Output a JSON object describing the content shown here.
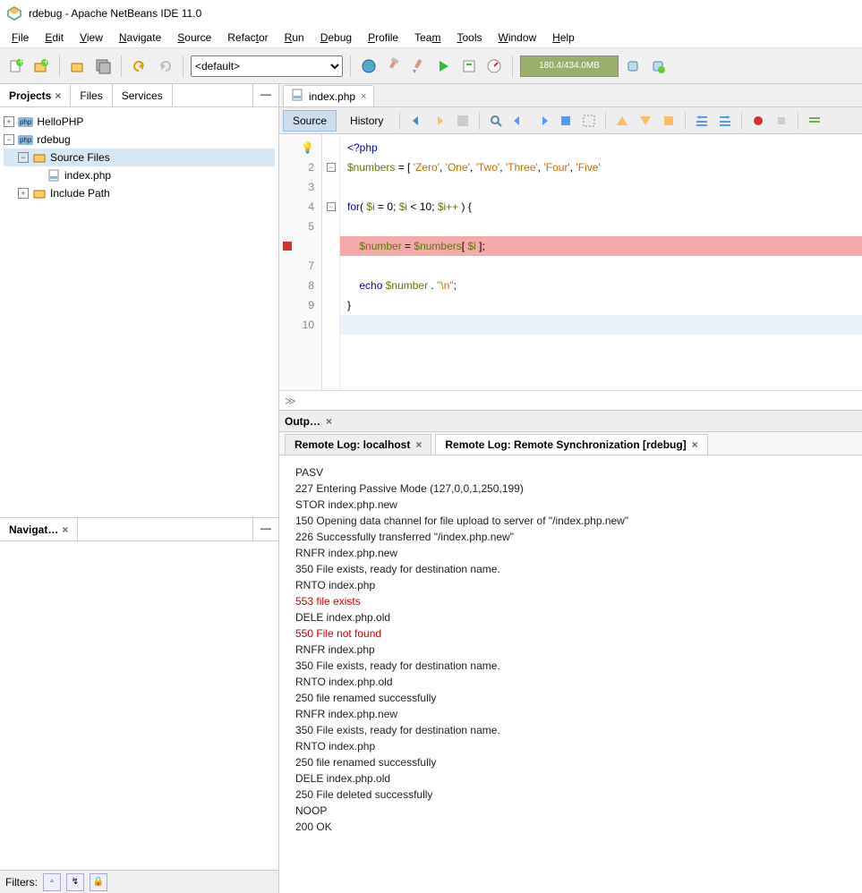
{
  "window": {
    "title": "rdebug - Apache NetBeans IDE 11.0"
  },
  "menus": [
    "File",
    "Edit",
    "View",
    "Navigate",
    "Source",
    "Refactor",
    "Run",
    "Debug",
    "Profile",
    "Team",
    "Tools",
    "Window",
    "Help"
  ],
  "toolbar": {
    "config": "<default>",
    "memory": "180.4/434.0MB"
  },
  "sidebar": {
    "tabs": {
      "projects": "Projects",
      "files": "Files",
      "services": "Services"
    },
    "tree": {
      "p0": "HelloPHP",
      "p1": "rdebug",
      "p1_src": "Source Files",
      "p1_src_file": "index.php",
      "p1_inc": "Include Path"
    },
    "navigator_title": "Navigat…",
    "filters_label": "Filters:"
  },
  "editor": {
    "tab": "index.php",
    "mode_source": "Source",
    "mode_history": "History",
    "code": {
      "l1": "<?php",
      "l2_a": "$numbers",
      "l2_b": " = [ ",
      "l2_c": "'Zero'",
      "l2_d": ", ",
      "l2_e": "'One'",
      "l2_f": ", ",
      "l2_g": "'Two'",
      "l2_h": ", ",
      "l2_i": "'Three'",
      "l2_j": ", ",
      "l2_k": "'Four'",
      "l2_l": ", ",
      "l2_m": "'Five'",
      "l4_a": "for",
      "l4_b": "( ",
      "l4_c": "$i",
      "l4_d": " = ",
      "l4_e": "0",
      "l4_f": "; ",
      "l4_g": "$i",
      "l4_h": " < ",
      "l4_i": "10",
      "l4_j": "; ",
      "l4_k": "$i++",
      "l4_l": " ) {",
      "l6_a": "$number",
      "l6_b": " = ",
      "l6_c": "$numbers",
      "l6_d": "[ ",
      "l6_e": "$i",
      "l6_f": " ];",
      "l8_a": "echo",
      "l8_b": " ",
      "l8_c": "$number",
      "l8_d": " . ",
      "l8_e": "\"\\n\"",
      "l8_f": ";",
      "l9": "}"
    }
  },
  "output": {
    "panel_title": "Outp…",
    "tab1": "Remote Log: localhost",
    "tab2": "Remote Log: Remote Synchronization [rdebug]",
    "lines": [
      {
        "t": "PASV"
      },
      {
        "t": "227 Entering Passive Mode (127,0,0,1,250,199)"
      },
      {
        "t": "STOR index.php.new"
      },
      {
        "t": "150 Opening data channel for file upload to server of \"/index.php.new\""
      },
      {
        "t": "226 Successfully transferred \"/index.php.new\""
      },
      {
        "t": "RNFR index.php.new"
      },
      {
        "t": "350 File exists, ready for destination name."
      },
      {
        "t": "RNTO index.php"
      },
      {
        "t": "553 file exists",
        "err": true
      },
      {
        "t": "DELE index.php.old"
      },
      {
        "t": "550 File not found",
        "err": true
      },
      {
        "t": "RNFR index.php"
      },
      {
        "t": "350 File exists, ready for destination name."
      },
      {
        "t": "RNTO index.php.old"
      },
      {
        "t": "250 file renamed successfully"
      },
      {
        "t": "RNFR index.php.new"
      },
      {
        "t": "350 File exists, ready for destination name."
      },
      {
        "t": "RNTO index.php"
      },
      {
        "t": "250 file renamed successfully"
      },
      {
        "t": "DELE index.php.old"
      },
      {
        "t": "250 File deleted successfully"
      },
      {
        "t": "NOOP"
      },
      {
        "t": "200 OK"
      }
    ]
  }
}
